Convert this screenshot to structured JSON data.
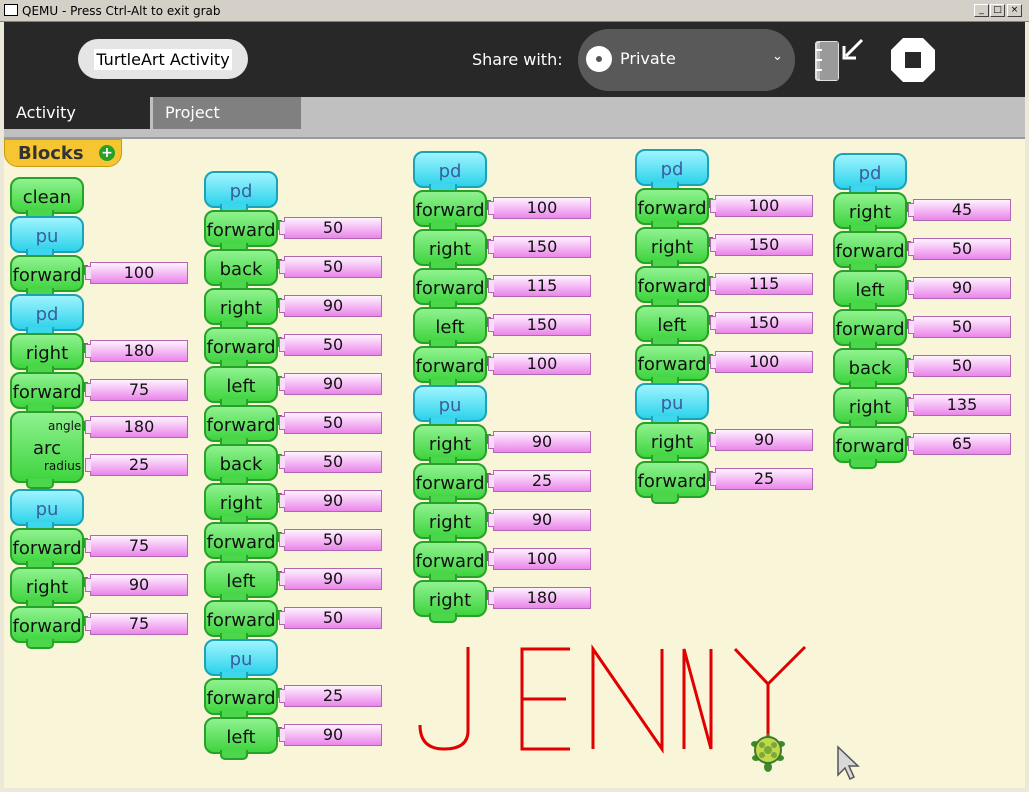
{
  "window": {
    "title": "QEMU - Press Ctrl-Alt to exit grab"
  },
  "toolbar": {
    "activity_title": "TurtleArt Activity",
    "share_label": "Share with:",
    "share_value": "Private"
  },
  "tabs": {
    "activity": "Activity",
    "project": "Project"
  },
  "palette": {
    "label": "Blocks"
  },
  "labels": {
    "angle": "angle",
    "radius": "radius"
  },
  "stacks": [
    [
      {
        "cmd": "clean"
      },
      {
        "cmd": "pu"
      },
      {
        "cmd": "forward",
        "arg": "100"
      },
      {
        "cmd": "pd"
      },
      {
        "cmd": "right",
        "arg": "180"
      },
      {
        "cmd": "forward",
        "arg": "75"
      },
      {
        "cmd": "arc",
        "args": [
          "180",
          "25"
        ]
      },
      {
        "cmd": "pu"
      },
      {
        "cmd": "forward",
        "arg": "75"
      },
      {
        "cmd": "right",
        "arg": "90"
      },
      {
        "cmd": "forward",
        "arg": "75"
      }
    ],
    [
      {
        "cmd": "pd"
      },
      {
        "cmd": "forward",
        "arg": "50"
      },
      {
        "cmd": "back",
        "arg": "50"
      },
      {
        "cmd": "right",
        "arg": "90"
      },
      {
        "cmd": "forward",
        "arg": "50"
      },
      {
        "cmd": "left",
        "arg": "90"
      },
      {
        "cmd": "forward",
        "arg": "50"
      },
      {
        "cmd": "back",
        "arg": "50"
      },
      {
        "cmd": "right",
        "arg": "90"
      },
      {
        "cmd": "forward",
        "arg": "50"
      },
      {
        "cmd": "left",
        "arg": "90"
      },
      {
        "cmd": "forward",
        "arg": "50"
      },
      {
        "cmd": "pu"
      },
      {
        "cmd": "forward",
        "arg": "25"
      },
      {
        "cmd": "left",
        "arg": "90"
      }
    ],
    [
      {
        "cmd": "pd"
      },
      {
        "cmd": "forward",
        "arg": "100"
      },
      {
        "cmd": "right",
        "arg": "150"
      },
      {
        "cmd": "forward",
        "arg": "115"
      },
      {
        "cmd": "left",
        "arg": "150"
      },
      {
        "cmd": "forward",
        "arg": "100"
      },
      {
        "cmd": "pu"
      },
      {
        "cmd": "right",
        "arg": "90"
      },
      {
        "cmd": "forward",
        "arg": "25"
      },
      {
        "cmd": "right",
        "arg": "90"
      },
      {
        "cmd": "forward",
        "arg": "100"
      },
      {
        "cmd": "right",
        "arg": "180"
      }
    ],
    [
      {
        "cmd": "pd"
      },
      {
        "cmd": "forward",
        "arg": "100"
      },
      {
        "cmd": "right",
        "arg": "150"
      },
      {
        "cmd": "forward",
        "arg": "115"
      },
      {
        "cmd": "left",
        "arg": "150"
      },
      {
        "cmd": "forward",
        "arg": "100"
      },
      {
        "cmd": "pu"
      },
      {
        "cmd": "right",
        "arg": "90"
      },
      {
        "cmd": "forward",
        "arg": "25"
      }
    ],
    [
      {
        "cmd": "pd"
      },
      {
        "cmd": "right",
        "arg": "45"
      },
      {
        "cmd": "forward",
        "arg": "50"
      },
      {
        "cmd": "left",
        "arg": "90"
      },
      {
        "cmd": "forward",
        "arg": "50"
      },
      {
        "cmd": "back",
        "arg": "50"
      },
      {
        "cmd": "right",
        "arg": "135"
      },
      {
        "cmd": "forward",
        "arg": "65"
      }
    ]
  ],
  "colors": {
    "pen": "#e00000",
    "canvas": "#f8f5d8",
    "turtle": "#6aa03a"
  }
}
